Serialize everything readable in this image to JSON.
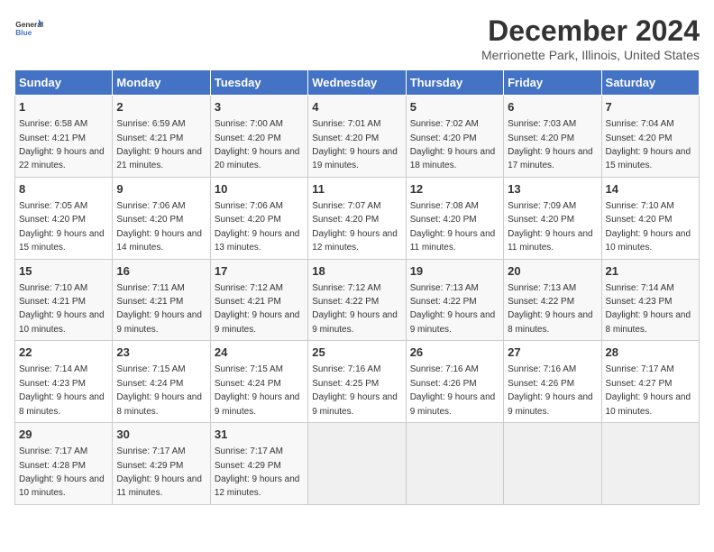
{
  "header": {
    "logo_line1": "General",
    "logo_line2": "Blue",
    "month_title": "December 2024",
    "location": "Merrionette Park, Illinois, United States"
  },
  "days_of_week": [
    "Sunday",
    "Monday",
    "Tuesday",
    "Wednesday",
    "Thursday",
    "Friday",
    "Saturday"
  ],
  "weeks": [
    [
      {
        "day": "1",
        "sunrise": "6:58 AM",
        "sunset": "4:21 PM",
        "daylight": "9 hours and 22 minutes."
      },
      {
        "day": "2",
        "sunrise": "6:59 AM",
        "sunset": "4:21 PM",
        "daylight": "9 hours and 21 minutes."
      },
      {
        "day": "3",
        "sunrise": "7:00 AM",
        "sunset": "4:20 PM",
        "daylight": "9 hours and 20 minutes."
      },
      {
        "day": "4",
        "sunrise": "7:01 AM",
        "sunset": "4:20 PM",
        "daylight": "9 hours and 19 minutes."
      },
      {
        "day": "5",
        "sunrise": "7:02 AM",
        "sunset": "4:20 PM",
        "daylight": "9 hours and 18 minutes."
      },
      {
        "day": "6",
        "sunrise": "7:03 AM",
        "sunset": "4:20 PM",
        "daylight": "9 hours and 17 minutes."
      },
      {
        "day": "7",
        "sunrise": "7:04 AM",
        "sunset": "4:20 PM",
        "daylight": "9 hours and 15 minutes."
      }
    ],
    [
      {
        "day": "8",
        "sunrise": "7:05 AM",
        "sunset": "4:20 PM",
        "daylight": "9 hours and 15 minutes."
      },
      {
        "day": "9",
        "sunrise": "7:06 AM",
        "sunset": "4:20 PM",
        "daylight": "9 hours and 14 minutes."
      },
      {
        "day": "10",
        "sunrise": "7:06 AM",
        "sunset": "4:20 PM",
        "daylight": "9 hours and 13 minutes."
      },
      {
        "day": "11",
        "sunrise": "7:07 AM",
        "sunset": "4:20 PM",
        "daylight": "9 hours and 12 minutes."
      },
      {
        "day": "12",
        "sunrise": "7:08 AM",
        "sunset": "4:20 PM",
        "daylight": "9 hours and 11 minutes."
      },
      {
        "day": "13",
        "sunrise": "7:09 AM",
        "sunset": "4:20 PM",
        "daylight": "9 hours and 11 minutes."
      },
      {
        "day": "14",
        "sunrise": "7:10 AM",
        "sunset": "4:20 PM",
        "daylight": "9 hours and 10 minutes."
      }
    ],
    [
      {
        "day": "15",
        "sunrise": "7:10 AM",
        "sunset": "4:21 PM",
        "daylight": "9 hours and 10 minutes."
      },
      {
        "day": "16",
        "sunrise": "7:11 AM",
        "sunset": "4:21 PM",
        "daylight": "9 hours and 9 minutes."
      },
      {
        "day": "17",
        "sunrise": "7:12 AM",
        "sunset": "4:21 PM",
        "daylight": "9 hours and 9 minutes."
      },
      {
        "day": "18",
        "sunrise": "7:12 AM",
        "sunset": "4:22 PM",
        "daylight": "9 hours and 9 minutes."
      },
      {
        "day": "19",
        "sunrise": "7:13 AM",
        "sunset": "4:22 PM",
        "daylight": "9 hours and 9 minutes."
      },
      {
        "day": "20",
        "sunrise": "7:13 AM",
        "sunset": "4:22 PM",
        "daylight": "9 hours and 8 minutes."
      },
      {
        "day": "21",
        "sunrise": "7:14 AM",
        "sunset": "4:23 PM",
        "daylight": "9 hours and 8 minutes."
      }
    ],
    [
      {
        "day": "22",
        "sunrise": "7:14 AM",
        "sunset": "4:23 PM",
        "daylight": "9 hours and 8 minutes."
      },
      {
        "day": "23",
        "sunrise": "7:15 AM",
        "sunset": "4:24 PM",
        "daylight": "9 hours and 8 minutes."
      },
      {
        "day": "24",
        "sunrise": "7:15 AM",
        "sunset": "4:24 PM",
        "daylight": "9 hours and 9 minutes."
      },
      {
        "day": "25",
        "sunrise": "7:16 AM",
        "sunset": "4:25 PM",
        "daylight": "9 hours and 9 minutes."
      },
      {
        "day": "26",
        "sunrise": "7:16 AM",
        "sunset": "4:26 PM",
        "daylight": "9 hours and 9 minutes."
      },
      {
        "day": "27",
        "sunrise": "7:16 AM",
        "sunset": "4:26 PM",
        "daylight": "9 hours and 9 minutes."
      },
      {
        "day": "28",
        "sunrise": "7:17 AM",
        "sunset": "4:27 PM",
        "daylight": "9 hours and 10 minutes."
      }
    ],
    [
      {
        "day": "29",
        "sunrise": "7:17 AM",
        "sunset": "4:28 PM",
        "daylight": "9 hours and 10 minutes."
      },
      {
        "day": "30",
        "sunrise": "7:17 AM",
        "sunset": "4:29 PM",
        "daylight": "9 hours and 11 minutes."
      },
      {
        "day": "31",
        "sunrise": "7:17 AM",
        "sunset": "4:29 PM",
        "daylight": "9 hours and 12 minutes."
      },
      null,
      null,
      null,
      null
    ]
  ]
}
